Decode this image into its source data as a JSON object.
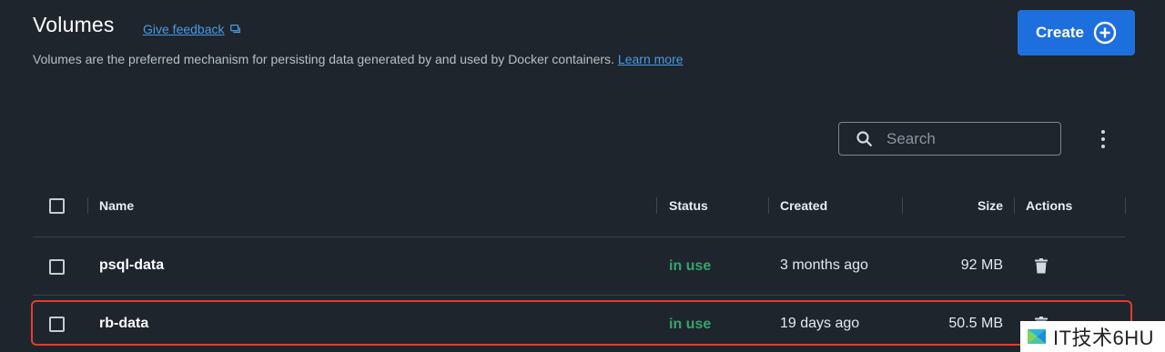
{
  "header": {
    "title": "Volumes",
    "feedback_label": "Give feedback",
    "subtitle": "Volumes are the preferred mechanism for persisting data generated by and used by Docker containers.",
    "learn_more": "Learn more",
    "create_label": "Create"
  },
  "toolbar": {
    "search_placeholder": "Search"
  },
  "table": {
    "columns": [
      "Name",
      "Status",
      "Created",
      "Size",
      "Actions"
    ],
    "rows": [
      {
        "name": "psql-data",
        "status": "in use",
        "created": "3 months ago",
        "size": "92 MB"
      },
      {
        "name": "rb-data",
        "status": "in use",
        "created": "19 days ago",
        "size": "50.5 MB"
      }
    ]
  },
  "watermark": {
    "text": "IT技术6HU"
  },
  "colors": {
    "background": "#1e252d",
    "accent": "#1d6fdd",
    "link": "#4a9ae8",
    "status_in_use": "#37a36b",
    "highlight": "#e53a2f"
  }
}
